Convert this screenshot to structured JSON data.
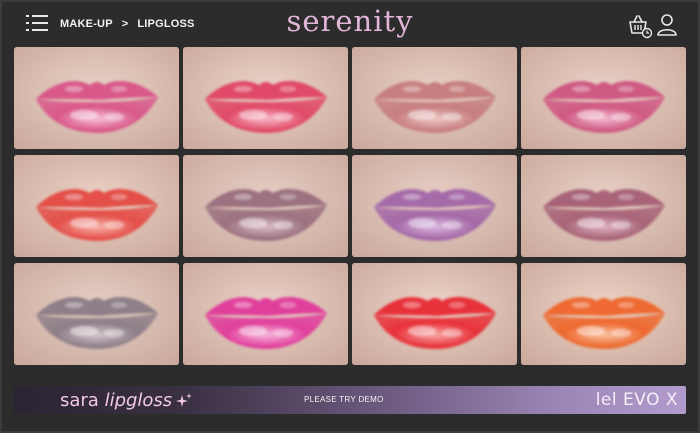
{
  "header": {
    "breadcrumb": {
      "category": "MAKE-UP",
      "separator": ">",
      "current": "LIPGLOSS"
    },
    "logo": "serenity",
    "icons": {
      "menu": "menu-icon",
      "cart": "shopping-basket-icon",
      "user": "user-icon"
    }
  },
  "swatches": [
    {
      "name": "shade-1",
      "lip": "#d9598a",
      "highlight": "#f7c0d8",
      "skin": "#ead3c8"
    },
    {
      "name": "shade-2",
      "lip": "#e04a68",
      "highlight": "#f8b9c6",
      "skin": "#ecd4c9"
    },
    {
      "name": "shade-3",
      "lip": "#c77f80",
      "highlight": "#efc7c4",
      "skin": "#e8d0c5"
    },
    {
      "name": "shade-4",
      "lip": "#cf5a84",
      "highlight": "#f3b8cf",
      "skin": "#ebd2c8"
    },
    {
      "name": "shade-5",
      "lip": "#e4504a",
      "highlight": "#f7b3a8",
      "skin": "#ecd2c6"
    },
    {
      "name": "shade-6",
      "lip": "#9c7180",
      "highlight": "#d9bcc6",
      "skin": "#e7cfc6"
    },
    {
      "name": "shade-7",
      "lip": "#a56aa8",
      "highlight": "#dcb7e0",
      "skin": "#e8d0c7"
    },
    {
      "name": "shade-8",
      "lip": "#a86478",
      "highlight": "#deb2c0",
      "skin": "#e9d1c7"
    },
    {
      "name": "shade-9",
      "lip": "#8e7f88",
      "highlight": "#d3c7cd",
      "skin": "#e6cfc6"
    },
    {
      "name": "shade-10",
      "lip": "#e0409c",
      "highlight": "#f6b6dc",
      "skin": "#ebd2c8"
    },
    {
      "name": "shade-11",
      "lip": "#e8333b",
      "highlight": "#f8a8a8",
      "skin": "#ecd3c8"
    },
    {
      "name": "shade-12",
      "lip": "#ee6a30",
      "highlight": "#f9c1a0",
      "skin": "#edd4c6"
    }
  ],
  "banner": {
    "title_plain": "sara ",
    "title_italic": "lipgloss",
    "sparkle_icon": "sparkle-icon",
    "cta": "PLEASE TRY DEMO",
    "brand_tag": "lel EVO X"
  },
  "colors": {
    "background": "#2c2c2c",
    "logo": "#e2b6d8",
    "banner_title": "#f1c9e6"
  }
}
